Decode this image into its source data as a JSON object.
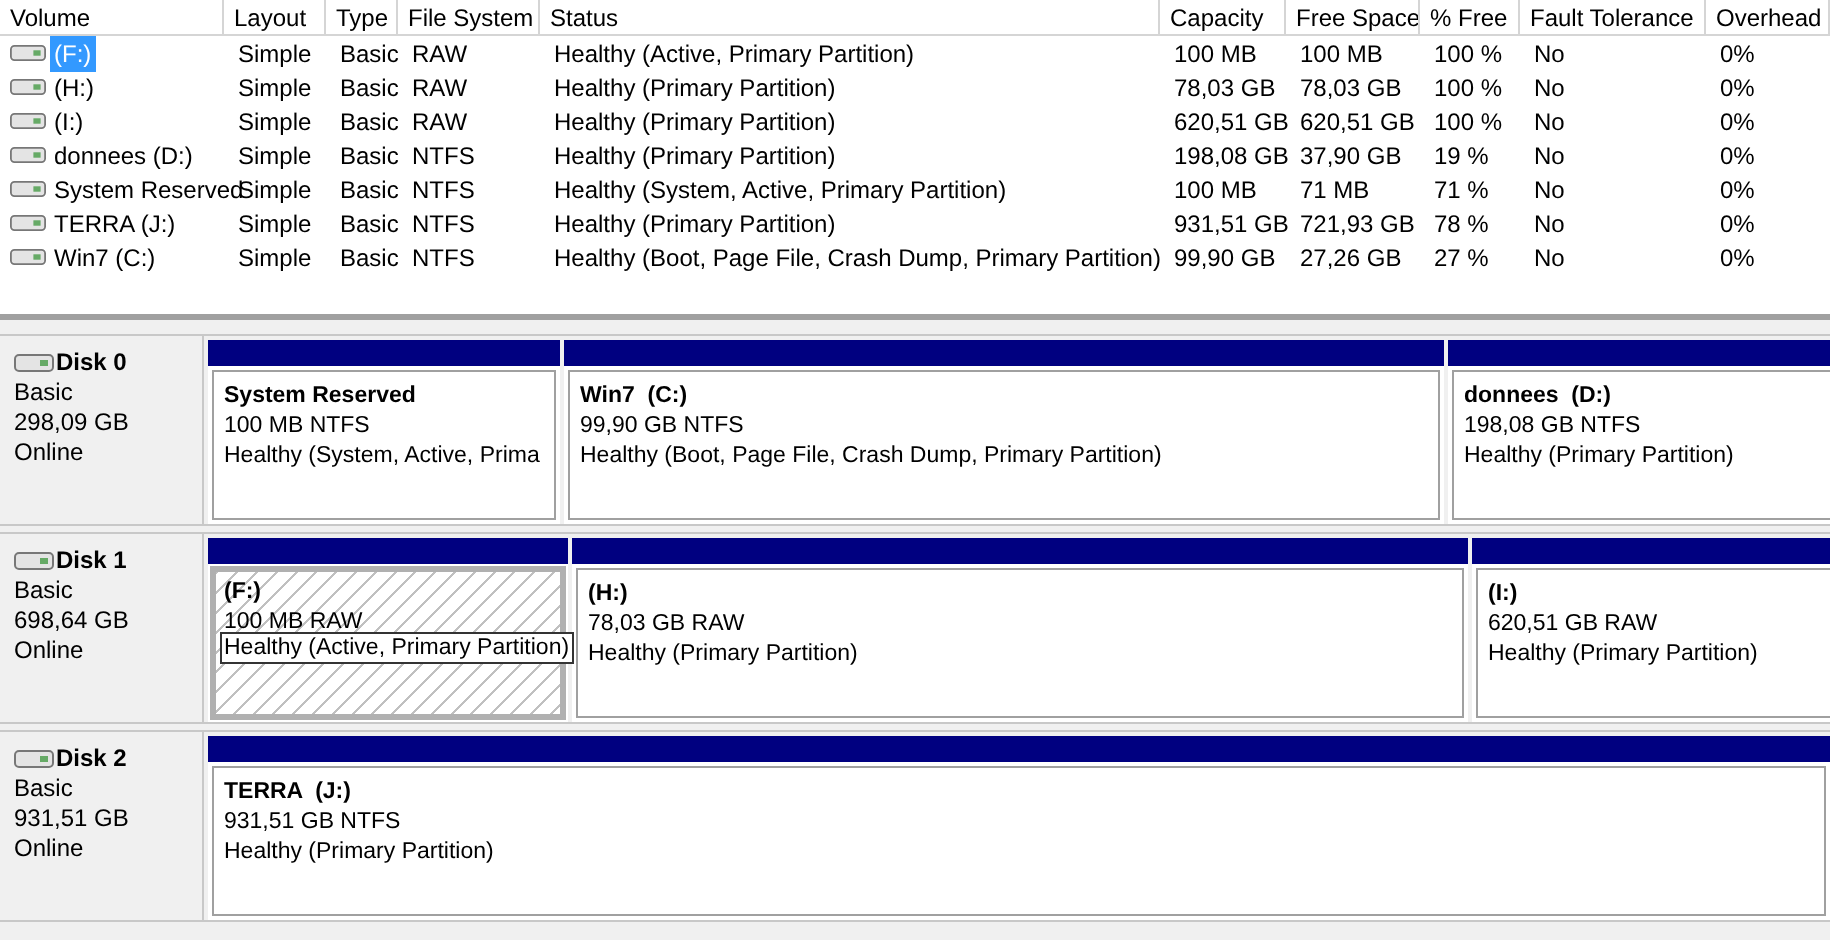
{
  "table": {
    "columns": [
      "Volume",
      "Layout",
      "Type",
      "File System",
      "Status",
      "Capacity",
      "Free Space",
      "% Free",
      "Fault Tolerance",
      "Overhead"
    ],
    "rows": [
      {
        "selected": true,
        "cells": [
          "(F:)",
          "Simple",
          "Basic",
          "RAW",
          "Healthy (Active, Primary Partition)",
          "100 MB",
          "100 MB",
          "100 %",
          "No",
          "0%"
        ]
      },
      {
        "selected": false,
        "cells": [
          "(H:)",
          "Simple",
          "Basic",
          "RAW",
          "Healthy (Primary Partition)",
          "78,03 GB",
          "78,03 GB",
          "100 %",
          "No",
          "0%"
        ]
      },
      {
        "selected": false,
        "cells": [
          "(I:)",
          "Simple",
          "Basic",
          "RAW",
          "Healthy (Primary Partition)",
          "620,51 GB",
          "620,51 GB",
          "100 %",
          "No",
          "0%"
        ]
      },
      {
        "selected": false,
        "cells": [
          "donnees (D:)",
          "Simple",
          "Basic",
          "NTFS",
          "Healthy (Primary Partition)",
          "198,08 GB",
          "37,90 GB",
          "19 %",
          "No",
          "0%"
        ]
      },
      {
        "selected": false,
        "cells": [
          "System Reserved",
          "Simple",
          "Basic",
          "NTFS",
          "Healthy (System, Active, Primary Partition)",
          "100 MB",
          "71 MB",
          "71 %",
          "No",
          "0%"
        ]
      },
      {
        "selected": false,
        "cells": [
          "TERRA (J:)",
          "Simple",
          "Basic",
          "NTFS",
          "Healthy (Primary Partition)",
          "931,51 GB",
          "721,93 GB",
          "78 %",
          "No",
          "0%"
        ]
      },
      {
        "selected": false,
        "cells": [
          "Win7 (C:)",
          "Simple",
          "Basic",
          "NTFS",
          "Healthy (Boot, Page File, Crash Dump, Primary Partition)",
          "99,90 GB",
          "27,26 GB",
          "27 %",
          "No",
          "0%"
        ]
      }
    ]
  },
  "disks": [
    {
      "name": "Disk 0",
      "type": "Basic",
      "size": "298,09 GB",
      "state": "Online",
      "partitions": [
        {
          "title": "System Reserved",
          "info": "100 MB NTFS",
          "status": "Healthy (System, Active, Prima",
          "selected": false
        },
        {
          "title": "Win7  (C:)",
          "info": "99,90 GB NTFS",
          "status": "Healthy (Boot, Page File, Crash Dump, Primary Partition)",
          "selected": false
        },
        {
          "title": "donnees  (D:)",
          "info": "198,08 GB NTFS",
          "status": "Healthy (Primary Partition)",
          "selected": false
        }
      ]
    },
    {
      "name": "Disk 1",
      "type": "Basic",
      "size": "698,64 GB",
      "state": "Online",
      "partitions": [
        {
          "title": "(F:)",
          "info": "100 MB RAW",
          "status": "Healthy (Active, Primary Partition)",
          "selected": true
        },
        {
          "title": "(H:)",
          "info": "78,03 GB RAW",
          "status": "Healthy (Primary Partition)",
          "selected": false
        },
        {
          "title": "(I:)",
          "info": "620,51 GB RAW",
          "status": "Healthy (Primary Partition)",
          "selected": false
        }
      ]
    },
    {
      "name": "Disk 2",
      "type": "Basic",
      "size": "931,51 GB",
      "state": "Online",
      "partitions": [
        {
          "title": "TERRA  (J:)",
          "info": "931,51 GB NTFS",
          "status": "Healthy (Primary Partition)",
          "selected": false
        }
      ]
    }
  ]
}
